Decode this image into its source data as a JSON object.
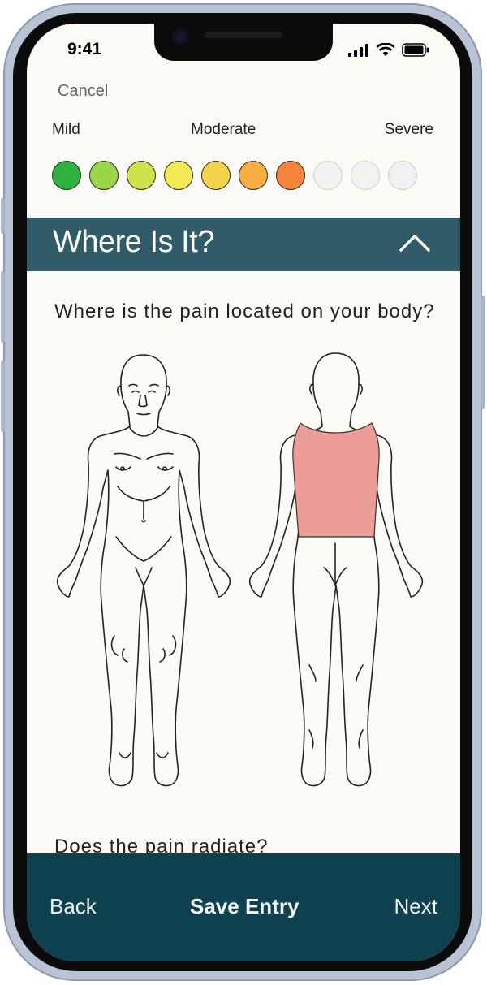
{
  "status_bar": {
    "time": "9:41"
  },
  "header": {
    "cancel_label": "Cancel"
  },
  "severity": {
    "labels": {
      "mild": "Mild",
      "moderate": "Moderate",
      "severe": "Severe"
    },
    "colors": [
      "#2fb142",
      "#9bd548",
      "#cfe24e",
      "#f2ea55",
      "#f4d24a",
      "#f8ae42",
      "#f7843a",
      "#f2f2f0",
      "#f2f2f0",
      "#f2f2f0"
    ],
    "selected_level": 7,
    "max_level": 10
  },
  "section": {
    "title": "Where Is It?",
    "toggle_icon": "chevron-up-icon",
    "bar_color": "#2f5c68"
  },
  "location": {
    "question": "Where is the pain located on your body?",
    "highlighted_region": "upper back",
    "highlight_color": "#ec9d98"
  },
  "radiate": {
    "question": "Does the pain radiate?"
  },
  "footer": {
    "back_label": "Back",
    "save_label": "Save Entry",
    "next_label": "Next",
    "bar_color": "#0e4150"
  }
}
